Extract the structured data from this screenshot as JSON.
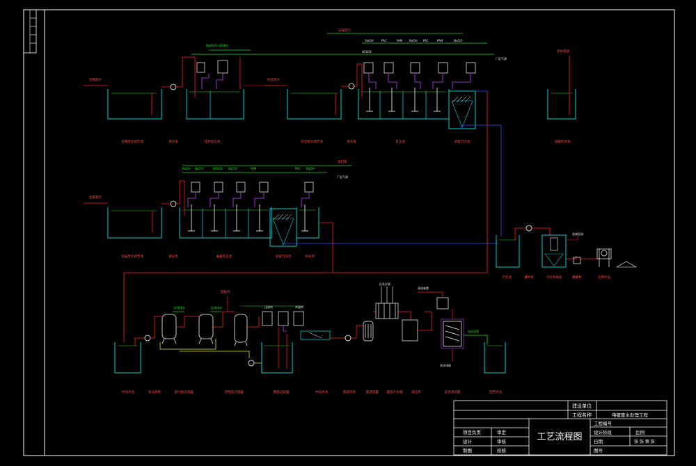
{
  "drawing": {
    "title": "工艺流程图",
    "colors": {
      "frame": "#ffffff",
      "tank": "#00d0d0",
      "pipe_red": "#ff2020",
      "pipe_green": "#20e020",
      "pipe_blue": "#3050ff",
      "pipe_yellow": "#e8e820",
      "pipe_purple": "#c040ff",
      "label": "#ff4a4a",
      "text": "#ffffff"
    }
  },
  "side_strip": {
    "cells": [
      "",
      "",
      "",
      "",
      ""
    ]
  },
  "title_block": {
    "unit_label": "建设单位",
    "project_label": "工程名称",
    "project_name": "电镀废水处理工程",
    "drawing_title": "工艺流程图",
    "left_rows": [
      {
        "a": "项目负责",
        "b": "审定"
      },
      {
        "a": "设计",
        "b": "审核"
      },
      {
        "a": "制图",
        "b": "校核"
      }
    ],
    "right_rows": [
      {
        "a": "工程编号",
        "b": ""
      },
      {
        "a": "设计阶段",
        "b": "比例"
      },
      {
        "a": "日期",
        "b": "张 张 第 张"
      },
      {
        "a": "图号",
        "b": ""
      }
    ]
  },
  "top_line_labels": {
    "air_header": "压缩空气",
    "to_air_1": "厂区气源",
    "to_air_2": "厂区气源",
    "dosing_header_2": "加药管"
  },
  "row1_labels": [
    "含铬废水调节池",
    "提升泵",
    "还原反应池",
    "综合废水调节池",
    "提升泵",
    "反应池",
    "斜管沉淀池",
    "排放检测池"
  ],
  "row1_inflow": [
    "含铬废水",
    "综合废水"
  ],
  "row1_reagents": [
    "NaHSO3",
    "H2SO4",
    "NaOH",
    "PAC",
    "PAM",
    "NaOH",
    "PAC",
    "PAM",
    "NaClO",
    "H2SO4"
  ],
  "row1_extra": "达标排放",
  "row2_labels": [
    "含氰废水调节池",
    "提升泵",
    "破氰反应池",
    "斜管沉淀池",
    "中间池"
  ],
  "row2_inflow": "含氰废水",
  "row2_reagents": [
    "NaOH",
    "NaClO",
    "H2SO4",
    "NaClO",
    "PAM",
    "PAC",
    "NaOH"
  ],
  "sludge_labels": [
    "污泥池",
    "螺杆泵",
    "污泥浓缩池",
    "叠螺机",
    "泥饼外运"
  ],
  "sludge_extra": "滤液回流",
  "row3_labels": [
    "中间水池",
    "多介质泵",
    "多介质过滤器",
    "活性炭过滤器",
    "精密过滤器",
    "中间水池",
    "超滤水泵",
    "超滤装置",
    "超滤产水箱",
    "高压泵",
    "反渗透装置",
    "回用水池"
  ],
  "row3_tags": [
    "反洗排水",
    "反洗排水",
    "阻垢剂",
    "还原剂",
    "杀菌剂",
    "反洗水泵",
    "清洗装置",
    "浓水排放",
    "淡水回用"
  ]
}
